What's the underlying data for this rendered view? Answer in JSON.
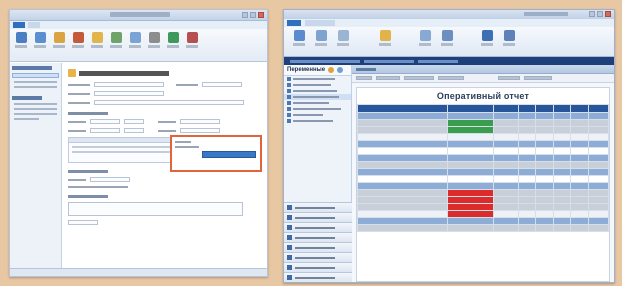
{
  "left_window": {
    "description_placeholder": ""
  },
  "right_window": {
    "nav_title": "Переменные",
    "report_title": "Оперативный отчет"
  },
  "colors": {
    "background": "#e8c7a3",
    "highlight_border": "#e0663a",
    "report_header": "#28569b",
    "status_green": "#3a9c4d",
    "status_red": "#dc2b2b"
  }
}
